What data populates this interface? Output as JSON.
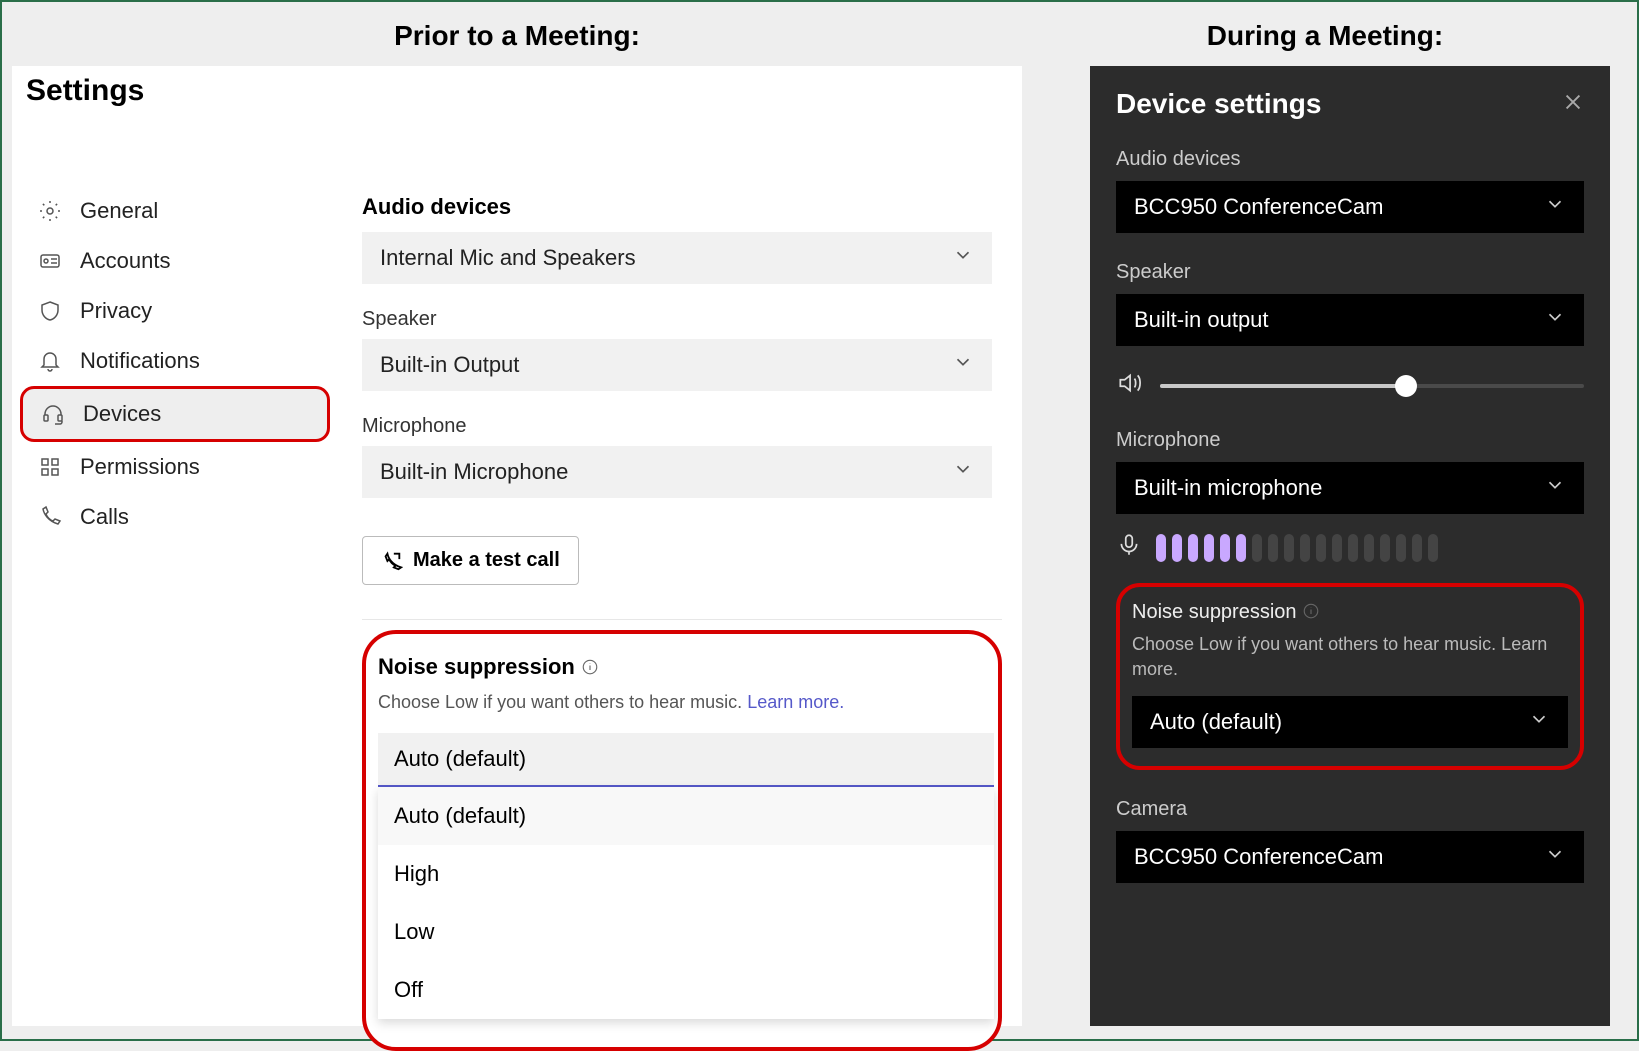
{
  "captions": {
    "left": "Prior to a Meeting:",
    "right": "During a Meeting:"
  },
  "light": {
    "title": "Settings",
    "sidebar": [
      {
        "icon": "gear",
        "label": "General"
      },
      {
        "icon": "account",
        "label": "Accounts"
      },
      {
        "icon": "shield",
        "label": "Privacy"
      },
      {
        "icon": "bell",
        "label": "Notifications"
      },
      {
        "icon": "headset",
        "label": "Devices",
        "selected": true
      },
      {
        "icon": "grid",
        "label": "Permissions"
      },
      {
        "icon": "phone",
        "label": "Calls"
      }
    ],
    "audio_devices": {
      "section_label": "Audio devices",
      "selected": "Internal Mic and Speakers",
      "speaker_label": "Speaker",
      "speaker_selected": "Built-in Output",
      "mic_label": "Microphone",
      "mic_selected": "Built-in Microphone"
    },
    "test_call_label": "Make a test call",
    "noise": {
      "title": "Noise suppression",
      "desc": "Choose Low if you want others to hear music.",
      "learn_more": "Learn more.",
      "selected": "Auto (default)",
      "options": [
        "Auto (default)",
        "High",
        "Low",
        "Off"
      ]
    }
  },
  "dark": {
    "title": "Device settings",
    "audio_devices": {
      "section_label": "Audio devices",
      "selected": "BCC950 ConferenceCam",
      "speaker_label": "Speaker",
      "speaker_selected": "Built-in output",
      "mic_label": "Microphone",
      "mic_selected": "Built-in microphone"
    },
    "mic_meter": {
      "total_bars": 18,
      "active_bars": 6
    },
    "noise": {
      "title": "Noise suppression",
      "desc_line1": "Choose Low if you want others to hear music. Learn",
      "desc_line2": "more.",
      "selected": "Auto (default)"
    },
    "camera": {
      "label": "Camera",
      "selected": "BCC950 ConferenceCam"
    }
  }
}
